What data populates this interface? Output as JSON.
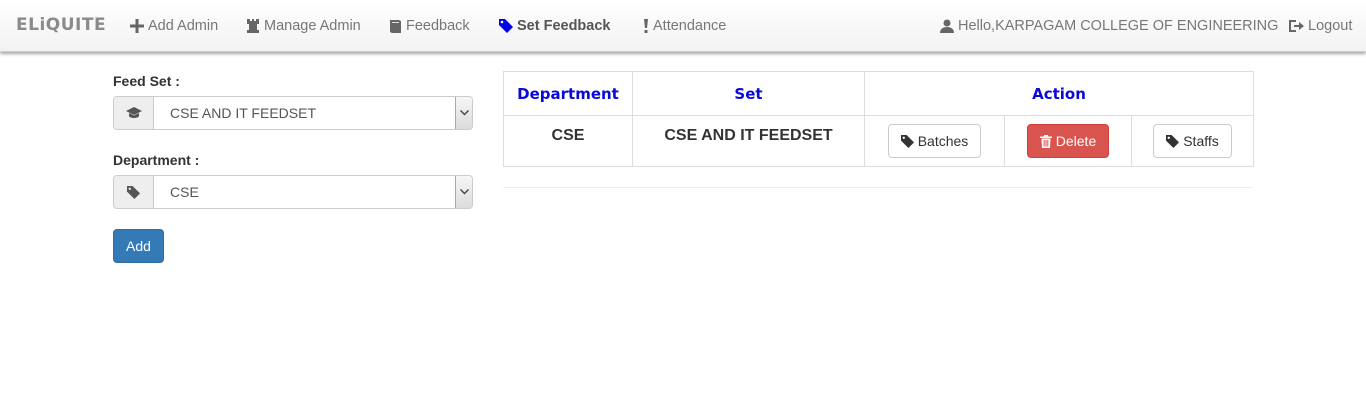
{
  "navbar": {
    "brand": "ELiQUITE",
    "items": [
      {
        "label": "Add Admin",
        "icon": "plus-icon"
      },
      {
        "label": "Manage Admin",
        "icon": "tower-icon"
      },
      {
        "label": "Feedback",
        "icon": "book-icon"
      },
      {
        "label": "Set Feedback",
        "icon": "tag-icon",
        "active": true
      },
      {
        "label": "Attendance",
        "icon": "exclamation-icon"
      }
    ],
    "user": {
      "label": "Hello,KARPAGAM COLLEGE OF ENGINEERING",
      "icon": "user-icon"
    },
    "logout": {
      "label": "Logout",
      "icon": "logout-icon"
    }
  },
  "form": {
    "feed_set": {
      "label": "Feed Set :",
      "value": "CSE AND IT FEEDSET",
      "icon": "graduation-cap-icon"
    },
    "department": {
      "label": "Department :",
      "value": "CSE",
      "icon": "tag-icon"
    },
    "add_label": "Add"
  },
  "table": {
    "headers": [
      "Department",
      "Set",
      "Action"
    ],
    "rows": [
      {
        "department": "CSE",
        "set": "CSE AND IT FEEDSET",
        "actions": {
          "batches": "Batches",
          "delete": "Delete",
          "staffs": "Staffs"
        }
      }
    ]
  },
  "colors": {
    "header_text": "#0a0ad6",
    "primary": "#337ab7",
    "danger": "#d9534f",
    "active_icon": "#0000ee"
  }
}
